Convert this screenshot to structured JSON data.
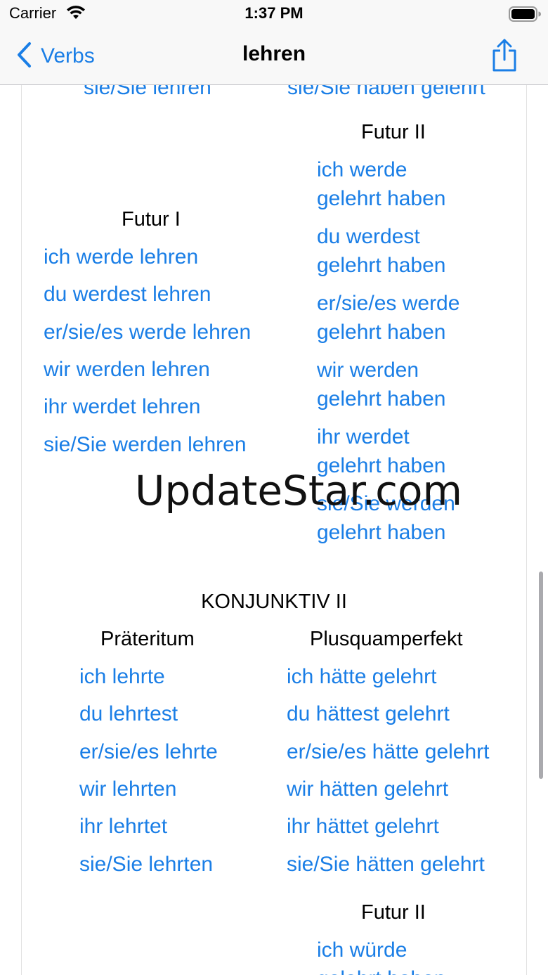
{
  "status": {
    "carrier": "Carrier",
    "time": "1:37 PM"
  },
  "nav": {
    "back_label": "Verbs",
    "title": "lehren"
  },
  "top": {
    "left_clipped": "sie/Sie lehren",
    "right_clipped": "sie/Sie haben gelehrt"
  },
  "futur1": {
    "heading": "Futur I",
    "forms": [
      "ich werde lehren",
      "du werdest lehren",
      "er/sie/es werde lehren",
      "wir werden lehren",
      "ihr werdet lehren",
      "sie/Sie werden lehren"
    ]
  },
  "futur2": {
    "heading": "Futur II",
    "forms": [
      [
        "ich werde",
        "gelehrt haben"
      ],
      [
        "du werdest",
        "gelehrt haben"
      ],
      [
        "er/sie/es werde",
        "gelehrt haben"
      ],
      [
        "wir werden",
        "gelehrt haben"
      ],
      [
        "ihr werdet",
        "gelehrt haben"
      ],
      [
        "sie/Sie werden",
        "gelehrt haben"
      ]
    ]
  },
  "konjunktiv2": {
    "heading": "KONJUNKTIV II",
    "praeteritum": {
      "heading": "Präteritum",
      "forms": [
        "ich lehrte",
        "du lehrtest",
        "er/sie/es lehrte",
        "wir lehrten",
        "ihr lehrtet",
        "sie/Sie lehrten"
      ]
    },
    "plusquamperfekt": {
      "heading": "Plusquamperfekt",
      "forms": [
        "ich hätte gelehrt",
        "du hättest gelehrt",
        "er/sie/es hätte gelehrt",
        "wir hätten gelehrt",
        "ihr hättet gelehrt",
        "sie/Sie hätten gelehrt"
      ]
    },
    "futur2": {
      "heading": "Futur II",
      "forms": [
        "ich würde",
        "gelehrt haben"
      ]
    }
  },
  "watermark": "UpdateStar.com"
}
